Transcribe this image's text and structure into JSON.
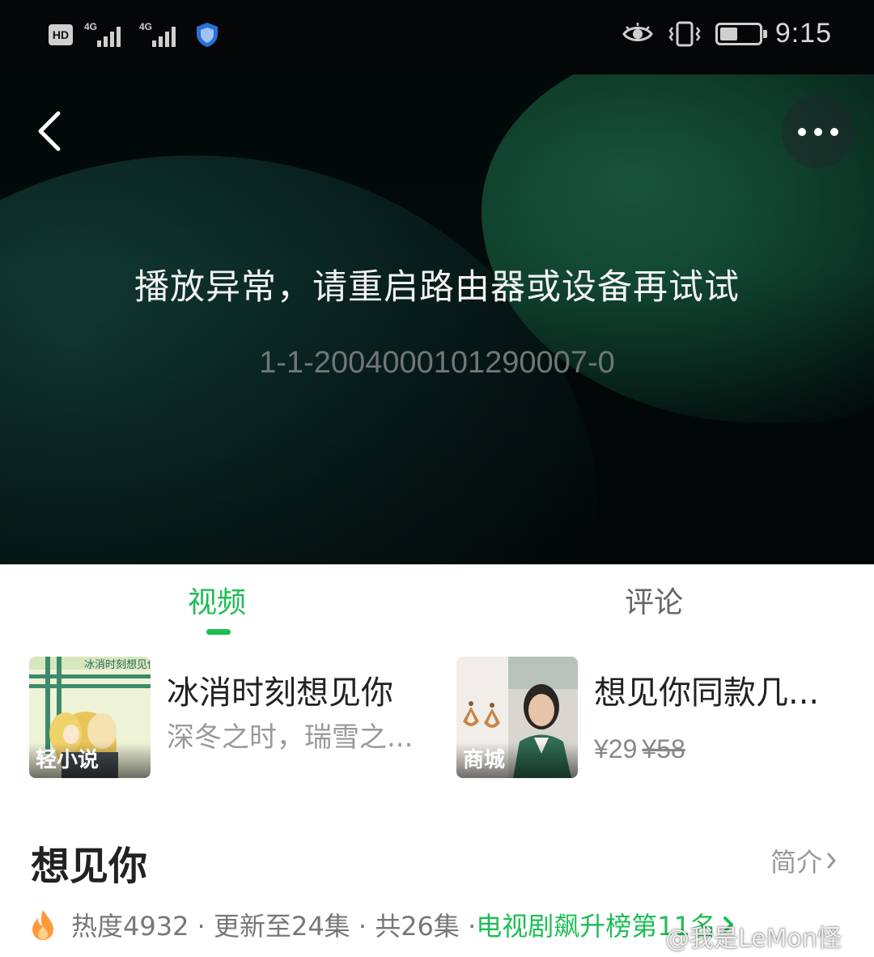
{
  "status_bar": {
    "hd_label": "HD",
    "sim1_network": "4G",
    "sim2_network": "4G",
    "time": "9:15",
    "battery_level": 0.45
  },
  "player": {
    "error_message": "播放异常，请重启路由器或设备再试试",
    "error_code": "1-1-2004000101290007-0"
  },
  "tabs": [
    {
      "label": "视频",
      "active": true
    },
    {
      "label": "评论",
      "active": false
    }
  ],
  "cards": [
    {
      "tag": "轻小说",
      "title": "冰消时刻想见你",
      "subtitle": "深冬之时，瑞雪之...",
      "thumb_text": "冰消时刻想见你"
    },
    {
      "tag": "商城",
      "title": "想见你同款几...",
      "price": "¥29",
      "original_price": "¥58"
    }
  ],
  "show": {
    "title": "想见你",
    "intro_link": "简介",
    "meta": "热度4932 · 更新至24集 · 共26集 · ",
    "rank": "电视剧飙升榜第11名"
  },
  "watermark": "@我是LeMon怪",
  "colors": {
    "accent": "#1dbd55",
    "player_bg": "#020a0a"
  }
}
